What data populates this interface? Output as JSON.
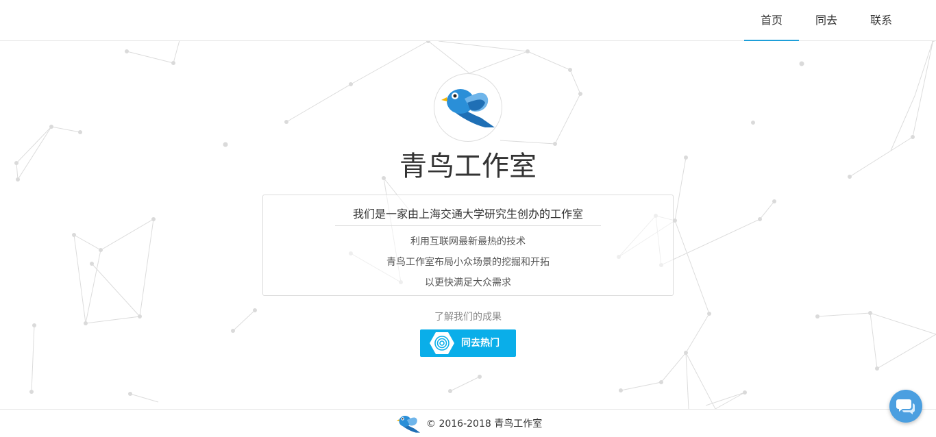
{
  "nav": {
    "items": [
      {
        "label": "首页",
        "active": true
      },
      {
        "label": "同去",
        "active": false
      },
      {
        "label": "联系",
        "active": false
      }
    ],
    "accent_color": "#1e9fd9"
  },
  "hero": {
    "logo_icon": "bluebird-icon",
    "title": "青鸟工作室",
    "intro": {
      "headline": "我们是一家由上海交通大学研究生创办的工作室",
      "lines": [
        "利用互联网最新最热的技术",
        "青鸟工作室布局小众场景的挖掘和开拓",
        "以更快满足大众需求"
      ]
    },
    "results_label": "了解我们的成果",
    "cta": {
      "label": "同去热门",
      "icon": "spiral-hexagon-icon",
      "color": "#0aaee9"
    }
  },
  "footer": {
    "icon": "bluebird-icon",
    "copyright": "© 2016-2018 青鸟工作室"
  },
  "chat": {
    "icon": "chat-bubbles-icon",
    "color": "#4b9fe0"
  }
}
